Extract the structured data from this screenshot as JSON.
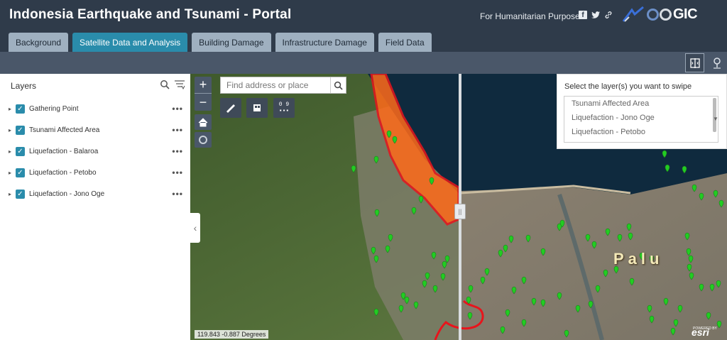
{
  "header": {
    "title": "Indonesia Earthquake and Tsunami - Portal",
    "humanitarian_text": "For Humanitarian Purpose",
    "social_icons": [
      "facebook-icon",
      "twitter-icon",
      "link-icon"
    ],
    "logo_text": "GIC"
  },
  "tabs": [
    {
      "label": "Background",
      "active": false
    },
    {
      "label": "Satellite Data and Analysis",
      "active": true
    },
    {
      "label": "Building Damage",
      "active": false
    },
    {
      "label": "Infrastructure Damage",
      "active": false
    },
    {
      "label": "Field Data",
      "active": false
    }
  ],
  "layers_panel": {
    "title": "Layers",
    "items": [
      {
        "label": "Gathering Point",
        "checked": true
      },
      {
        "label": "Tsunami Affected Area",
        "checked": true
      },
      {
        "label": "Liquefaction - Balaroa",
        "checked": true
      },
      {
        "label": "Liquefaction - Petobo",
        "checked": true
      },
      {
        "label": "Liquefaction - Jono Oge",
        "checked": true
      }
    ],
    "more_label": "•••"
  },
  "map": {
    "search_placeholder": "Find address or place",
    "zoom_in": "+",
    "zoom_out": "−",
    "coords_tool_top": "0 9",
    "coords_tool_bottom": "▪▪▪",
    "place_label": "Palu",
    "coordinate_readout": "119.843 -0.887 Degrees",
    "attribution": "esri",
    "powered_by": "POWERED BY"
  },
  "swipe_panel": {
    "title": "Select the layer(s) you want to swipe",
    "options": [
      "Tsunami Affected Area",
      "Liquefaction - Jono Oge",
      "Liquefaction - Petobo"
    ]
  },
  "colors": {
    "header_bg": "#2f3b4a",
    "tab_active": "#2a8cab",
    "tab_inactive": "#9fb0c0",
    "tsunami_fill": "#ff6a1a",
    "tsunami_outline": "#e8141c",
    "gathering_point": "#22cc22"
  }
}
